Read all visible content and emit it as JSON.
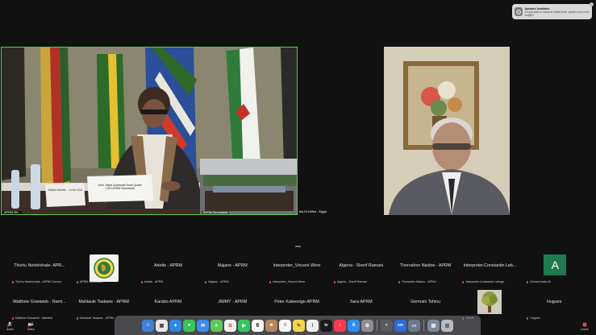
{
  "notification": {
    "title": "Updates Available",
    "body": "Do you want to restart to install these updates now or try tonight?"
  },
  "main_videos": {
    "left_label": "APRM SE...",
    "left_nameplate_1": "Amb. Marie-Antoinette Rose-Quatre",
    "left_nameplate_2": "CEO APRM Secretariat",
    "left_nameplate_sa": "Batsha Makhile ... to the UDG",
    "left_small_label": "APRM Secretariat",
    "right_label": "Aly El-Hefna - Egypt"
  },
  "tiles_row1": [
    {
      "name": "Thivhu Netshivhale- APR...",
      "sub": "Thivhu Netshivhale - APRM Commu",
      "kind": "text"
    },
    {
      "name": "",
      "sub": "APRM Secretariat",
      "kind": "logo"
    },
    {
      "name": "Arlette - APRM",
      "sub": "Arlette - APRM",
      "kind": "text"
    },
    {
      "name": "Majane - APRM",
      "sub": "Majane - APRM",
      "kind": "text"
    },
    {
      "name": "Interpreter_Vincent Were",
      "sub": "Interpreter_Vincent Were",
      "kind": "text"
    },
    {
      "name": "Algeria - Sherif Ramani",
      "sub": "Algeria - Sherif Ramani",
      "kind": "text"
    },
    {
      "name": "Theroshen Naidoo - APRM",
      "sub": "Theroshen Naidoo - APRM",
      "kind": "text"
    },
    {
      "name": "Interpreter.Constantin Leb...",
      "sub": "Interpreter.Constantin Lebugo",
      "kind": "text"
    },
    {
      "name": "A",
      "sub": "Ahmed Arafa Ali",
      "kind": "avatar"
    }
  ],
  "tiles_row2": [
    {
      "name": "Matthew Gowaseb - Nami...",
      "sub": "Matthew Gowaseb - Namibia",
      "kind": "text"
    },
    {
      "name": "Mahlaule Tsakane - APRM",
      "sub": "Mahlaule Tsakane - APRM",
      "kind": "text"
    },
    {
      "name": "Karabo APRM",
      "sub": "",
      "kind": "text"
    },
    {
      "name": "JIMMY - APRM",
      "sub": "",
      "kind": "text"
    },
    {
      "name": "Peter Katwesige-APRM",
      "sub": "",
      "kind": "text"
    },
    {
      "name": "Sara APRM",
      "sub": "",
      "kind": "text"
    },
    {
      "name": "Germain Tshinu",
      "sub": "",
      "kind": "text"
    },
    {
      "name": "",
      "sub": "Gisele",
      "kind": "tree"
    },
    {
      "name": "Hugues",
      "sub": "Hugues",
      "kind": "text"
    }
  ],
  "controls": {
    "audio_label": "Audio",
    "video_label": "Video",
    "leave_label": "Leave"
  },
  "dock": {
    "calendar_day": "6"
  },
  "colors": {
    "active_speaker_border": "#59c94f",
    "avatar_bg": "#1f7a4f",
    "mic_muted": "#e04848"
  }
}
